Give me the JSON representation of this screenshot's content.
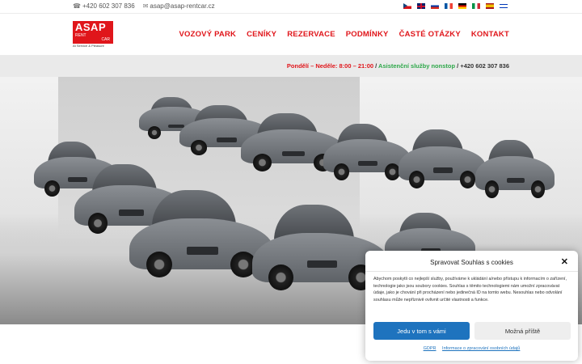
{
  "topbar": {
    "phone": "+420 602 307 836",
    "email": "asap@asap-rentcar.cz",
    "phone_icon": "phone-icon",
    "email_icon": "envelope-icon",
    "languages": [
      "cs",
      "en",
      "ru",
      "fr",
      "de",
      "it",
      "es",
      "he"
    ]
  },
  "logo": {
    "main": "ASAP",
    "rent": "RENT",
    "car": "CAR",
    "tagline": "At Service & Pleasure"
  },
  "nav": {
    "items": [
      "VOZOVÝ PARK",
      "CENÍKY",
      "REZERVACE",
      "PODMÍNKY",
      "ČASTÉ OTÁZKY",
      "KONTAKT"
    ]
  },
  "strip": {
    "hours": "Pondělí – Neděle: 8:00 – 21:00",
    "sep1": " / ",
    "assist": "Asistenční služby nonstop",
    "sep2": " / ",
    "phone": "+420 602 307 836"
  },
  "colors": {
    "brand_red": "#e0161b",
    "assist_green": "#2ea84a",
    "accept_blue": "#1e73be"
  },
  "cookie": {
    "title": "Spravovat Souhlas s cookies",
    "text": "Abychom poskytli co nejlepší služby, používáme k ukládání a/nebo přístupu k informacím o zařízení, technologie jako jsou soubory cookies. Souhlas s těmito technologiemi nám umožní zpracovávat údaje, jako je chování při procházení nebo jedinečná ID na tomto webu. Nesouhlas nebo odvolání souhlasu může nepříznivě ovlivnit určité vlastnosti a funkce.",
    "accept": "Jedu v tom s vámi",
    "preferences": "Možná příště",
    "link_gdpr": "GDPR",
    "link_privacy": "Informace o zpracování osobních údajů"
  }
}
